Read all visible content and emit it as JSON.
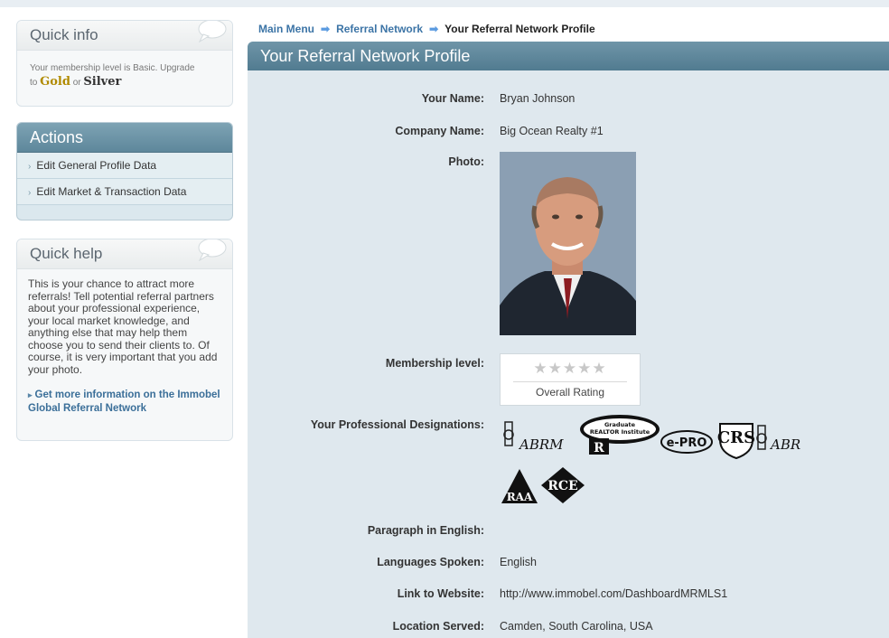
{
  "sidebar": {
    "quick_info": {
      "title": "Quick info",
      "text": "Your membership level is Basic. Upgrade",
      "to": "to",
      "gold": "Gold",
      "or": "or",
      "silver": "Silver"
    },
    "actions": {
      "title": "Actions",
      "items": [
        {
          "label": "Edit General Profile Data"
        },
        {
          "label": "Edit Market & Transaction Data"
        }
      ]
    },
    "quick_help": {
      "title": "Quick help",
      "text": "This is your chance to attract more referrals! Tell potential referral partners about your professional experience, your local market knowledge, and anything else that may help them choose you to send their clients to. Of course, it is very important that you add your photo.",
      "link": "Get more information on the Immobel Global Referral Network"
    }
  },
  "breadcrumb": {
    "items": [
      "Main Menu",
      "Referral Network"
    ],
    "current": "Your Referral Network Profile"
  },
  "profile": {
    "title": "Your Referral Network Profile",
    "labels": {
      "name": "Your Name:",
      "company": "Company Name:",
      "photo": "Photo:",
      "membership": "Membership level:",
      "designations": "Your Professional Designations:",
      "paragraph": "Paragraph in English:",
      "languages": "Languages Spoken:",
      "website": "Link to Website:",
      "location": "Location Served:"
    },
    "values": {
      "name": "Bryan Johnson",
      "company": "Big Ocean Realty #1",
      "rating_stars": "★★★★★",
      "rating_label": "Overall Rating",
      "languages": "English",
      "website": "http://www.immobel.com/DashboardMRMLS1",
      "location": "Camden, South Carolina, USA"
    },
    "designation_logos": [
      "ABRM",
      "Graduate REALTOR Institute",
      "e-PRO",
      "CRS",
      "ABR",
      "RAA",
      "RCE"
    ]
  },
  "colors": {
    "panel_bg": "#dfe8ee",
    "header_bar": "#5e879b",
    "link": "#3c74a6",
    "gold": "#b08a00"
  }
}
